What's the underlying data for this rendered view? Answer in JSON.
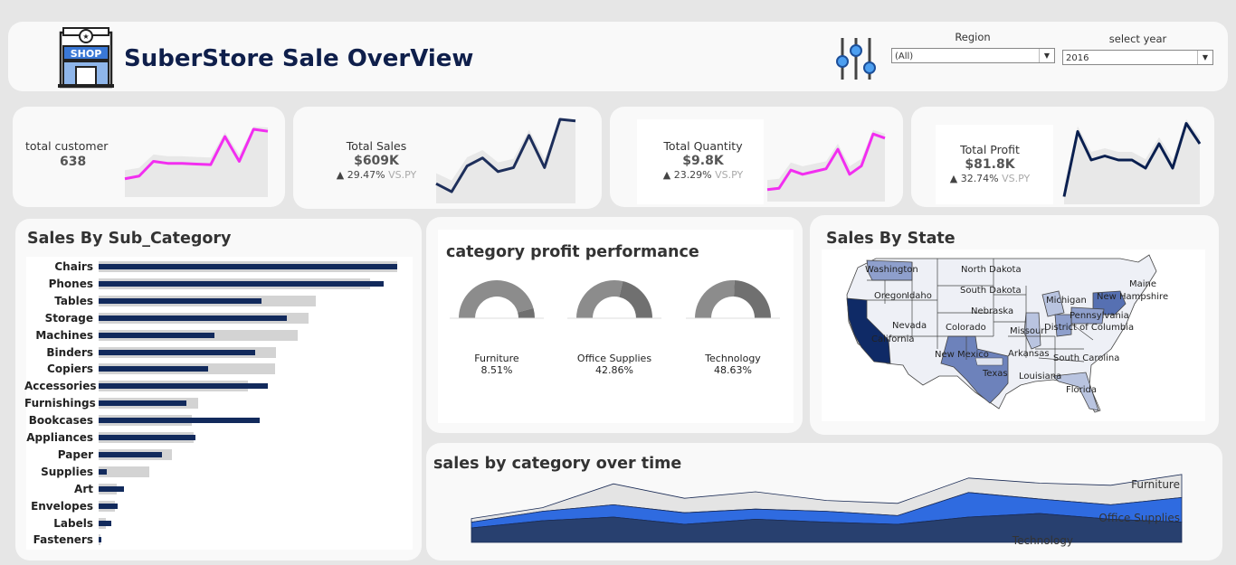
{
  "header": {
    "title": "SuberStore Sale OverView",
    "logo_text": "SHOP",
    "filters": {
      "region": {
        "label": "Region",
        "selected": "(All)"
      },
      "year": {
        "label": "select year",
        "selected": "2016"
      }
    }
  },
  "kpis": [
    {
      "label": "total customer",
      "value": "638",
      "delta": "",
      "vs": "",
      "line_color": "#f22ef0",
      "sparkline": [
        0.22,
        0.26,
        0.48,
        0.45,
        0.45,
        0.44,
        0.43,
        0.85,
        0.48,
        0.96,
        0.93
      ]
    },
    {
      "label": "Total Sales",
      "value": "$609K",
      "delta": "▲ 29.47%",
      "vs": "VS.PY",
      "line_color": "#1d2e5a",
      "sparkline": [
        0.2,
        0.1,
        0.42,
        0.52,
        0.35,
        0.4,
        0.8,
        0.4,
        1.0,
        0.98
      ]
    },
    {
      "label": "Total Quantity",
      "value": "$9.8K",
      "delta": "▲ 23.29%",
      "vs": "VS.PY",
      "line_color": "#f22ef0",
      "sparkline": [
        0.12,
        0.14,
        0.4,
        0.34,
        0.38,
        0.42,
        0.7,
        0.34,
        0.46,
        0.92,
        0.86
      ]
    },
    {
      "label": "Total Profit",
      "value": "$81.8K",
      "delta": "▲ 32.74%",
      "vs": "VS.PY",
      "line_color": "#0a1f4f",
      "sparkline": [
        0.05,
        0.85,
        0.5,
        0.55,
        0.5,
        0.5,
        0.4,
        0.7,
        0.4,
        0.95,
        0.7
      ]
    }
  ],
  "sub_category": {
    "title": "Sales By Sub_Category",
    "items": [
      {
        "name": "Chairs",
        "current": 330,
        "previous": 330
      },
      {
        "name": "Phones",
        "current": 315,
        "previous": 300
      },
      {
        "name": "Tables",
        "current": 180,
        "previous": 240
      },
      {
        "name": "Storage",
        "current": 208,
        "previous": 232
      },
      {
        "name": "Machines",
        "current": 128,
        "previous": 220
      },
      {
        "name": "Binders",
        "current": 173,
        "previous": 196
      },
      {
        "name": "Copiers",
        "current": 121,
        "previous": 195
      },
      {
        "name": "Accessories",
        "current": 187,
        "previous": 165
      },
      {
        "name": "Furnishings",
        "current": 97,
        "previous": 110
      },
      {
        "name": "Bookcases",
        "current": 178,
        "previous": 103
      },
      {
        "name": "Appliances",
        "current": 107,
        "previous": 105
      },
      {
        "name": "Paper",
        "current": 70,
        "previous": 81
      },
      {
        "name": "Supplies",
        "current": 9,
        "previous": 56
      },
      {
        "name": "Art",
        "current": 28,
        "previous": 20
      },
      {
        "name": "Envelopes",
        "current": 21,
        "previous": 18
      },
      {
        "name": "Labels",
        "current": 14,
        "previous": 8
      },
      {
        "name": "Fasteners",
        "current": 3,
        "previous": 2
      }
    ]
  },
  "category_profit": {
    "title": "category profit performance",
    "items": [
      {
        "name": "Furniture",
        "percent": "8.51%",
        "value": 8.51
      },
      {
        "name": "Office Supplies",
        "percent": "42.86%",
        "value": 42.86
      },
      {
        "name": "Technology",
        "percent": "48.63%",
        "value": 48.63
      }
    ]
  },
  "state_map": {
    "title": "Sales By State",
    "labels": [
      "Washington",
      "Oregon",
      "Idaho",
      "North Dakota",
      "South Dakota",
      "Nebraska",
      "Nevada",
      "California",
      "Colorado",
      "New Mexico",
      "Texas",
      "Missouri",
      "Arkansas",
      "Louisiana",
      "Michigan",
      "Pennsylvania",
      "New Hampshire",
      "Maine",
      "District of Columbia",
      "South Carolina",
      "Florida"
    ]
  },
  "time_area": {
    "title": "sales by category over time",
    "series": [
      {
        "name": "Furniture",
        "color": "#e4e4e4"
      },
      {
        "name": "Office Supplies",
        "color": "#2f6be0"
      },
      {
        "name": "Technology",
        "color": "#28406f"
      }
    ],
    "chart_data": {
      "type": "area",
      "series": [
        {
          "name": "Technology",
          "values": [
            2.0,
            3.0,
            3.5,
            2.5,
            3.2,
            2.8,
            2.5,
            3.5,
            4.0,
            3.2,
            2.8
          ]
        },
        {
          "name": "Office Supplies",
          "values": [
            0.8,
            1.3,
            1.7,
            1.6,
            1.4,
            1.5,
            1.2,
            3.4,
            2.0,
            2.0,
            3.4
          ]
        },
        {
          "name": "Furniture",
          "values": [
            0.5,
            0.5,
            2.9,
            2.0,
            2.4,
            1.5,
            1.7,
            2.0,
            2.2,
            2.7,
            3.2
          ]
        }
      ]
    }
  }
}
